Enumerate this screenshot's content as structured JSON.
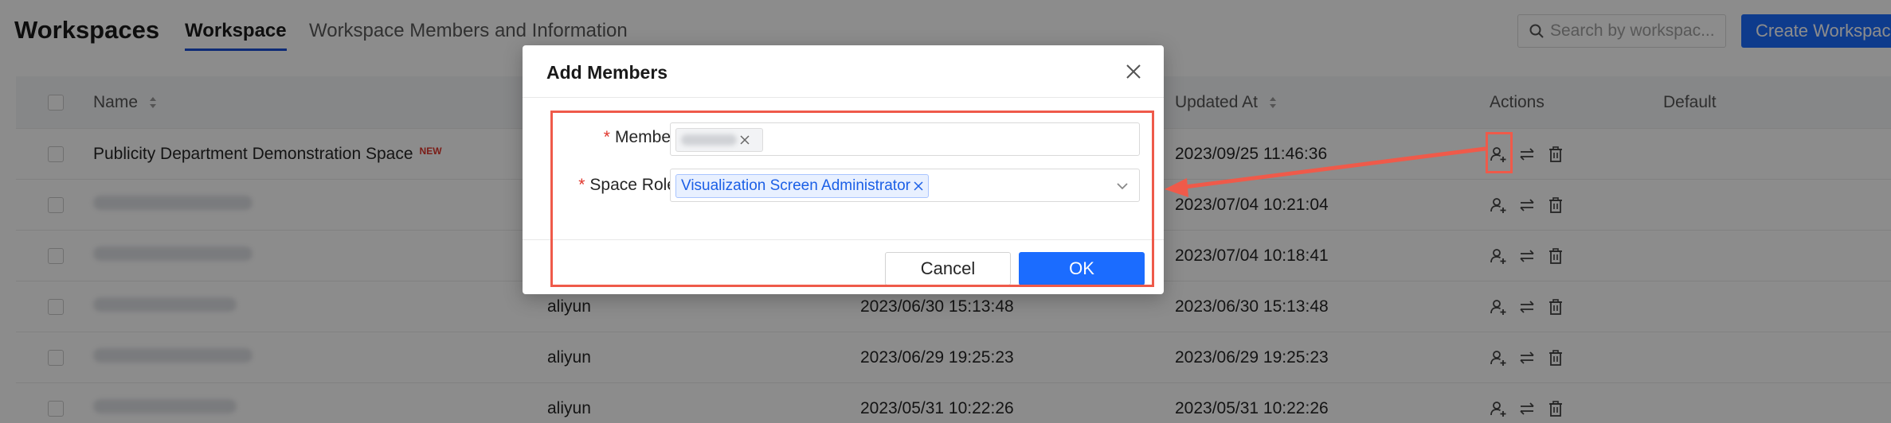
{
  "header": {
    "title": "Workspaces",
    "tabs": [
      {
        "label": "Workspace",
        "active": true
      },
      {
        "label": "Workspace Members and Information",
        "active": false
      }
    ],
    "search_placeholder": "Search by workspac...",
    "create_label": "Create Workspace"
  },
  "table": {
    "columns": {
      "name": "Name",
      "updated": "Updated At",
      "actions": "Actions",
      "default": "Default"
    },
    "rows": [
      {
        "name": "Publicity Department Demonstration Space",
        "badge": "NEW",
        "owner": "",
        "created": "",
        "updated": "2023/09/25 11:46:36"
      },
      {
        "name": "",
        "owner": "",
        "created": "",
        "updated": "2023/07/04 10:21:04"
      },
      {
        "name": "",
        "owner": "",
        "created": "",
        "updated": "2023/07/04 10:18:41"
      },
      {
        "name": "",
        "owner": "aliyun",
        "created": "2023/06/30 15:13:48",
        "updated": "2023/06/30 15:13:48"
      },
      {
        "name": "",
        "owner": "aliyun",
        "created": "2023/06/29 19:25:23",
        "updated": "2023/06/29 19:25:23"
      },
      {
        "name": "",
        "owner": "aliyun",
        "created": "2023/05/31 10:22:26",
        "updated": "2023/05/31 10:22:26"
      }
    ]
  },
  "modal": {
    "title": "Add Members",
    "member_label": "Member",
    "role_label": "Space Role",
    "role_tag": "Visualization Screen Administrator",
    "cancel_label": "Cancel",
    "ok_label": "OK"
  },
  "colors": {
    "primary": "#1b6cff",
    "annotation": "#ef5a4a",
    "required": "#e0352b"
  },
  "icons": [
    "search-icon",
    "sort-icon",
    "add-member-icon",
    "transfer-icon",
    "delete-icon",
    "close-icon",
    "chevron-down-icon"
  ]
}
